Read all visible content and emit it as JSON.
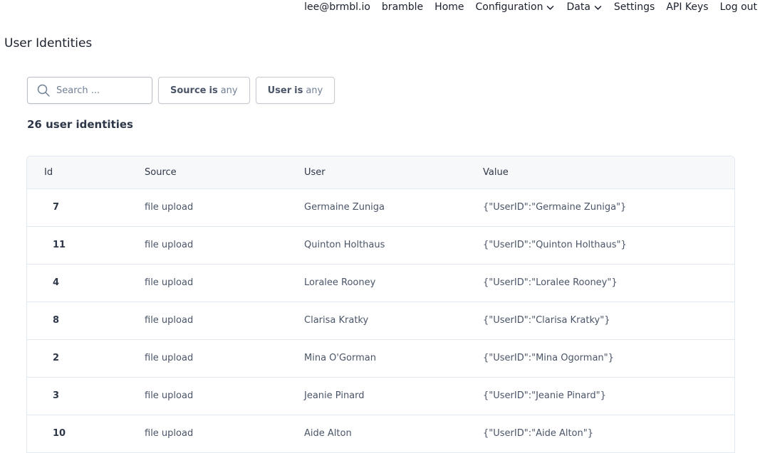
{
  "nav": {
    "email": "lee@brmbl.io",
    "org": "bramble",
    "home": "Home",
    "configuration": "Configuration",
    "data": "Data",
    "settings": "Settings",
    "api_keys": "API Keys",
    "logout": "Log out"
  },
  "page": {
    "title": "User Identities",
    "count_label": "26 user identities"
  },
  "filters": {
    "search_placeholder": "Search ...",
    "search_value": "",
    "source": {
      "field": "Source",
      "op": "is",
      "value": "any"
    },
    "user": {
      "field": "User",
      "op": "is",
      "value": "any"
    }
  },
  "table": {
    "columns": [
      "Id",
      "Source",
      "User",
      "Value"
    ],
    "rows": [
      {
        "id": "7",
        "source": "file upload",
        "user": "Germaine Zuniga",
        "value": "{\"UserID\":\"Germaine Zuniga\"}"
      },
      {
        "id": "11",
        "source": "file upload",
        "user": "Quinton Holthaus",
        "value": "{\"UserID\":\"Quinton Holthaus\"}"
      },
      {
        "id": "4",
        "source": "file upload",
        "user": "Loralee Rooney",
        "value": "{\"UserID\":\"Loralee Rooney\"}"
      },
      {
        "id": "8",
        "source": "file upload",
        "user": "Clarisa Kratky",
        "value": "{\"UserID\":\"Clarisa Kratky\"}"
      },
      {
        "id": "2",
        "source": "file upload",
        "user": "Mina O'Gorman",
        "value": "{\"UserID\":\"Mina Ogorman\"}"
      },
      {
        "id": "3",
        "source": "file upload",
        "user": "Jeanie Pinard",
        "value": "{\"UserID\":\"Jeanie Pinard\"}"
      },
      {
        "id": "10",
        "source": "file upload",
        "user": "Aide Alton",
        "value": "{\"UserID\":\"Aide Alton\"}"
      }
    ]
  }
}
